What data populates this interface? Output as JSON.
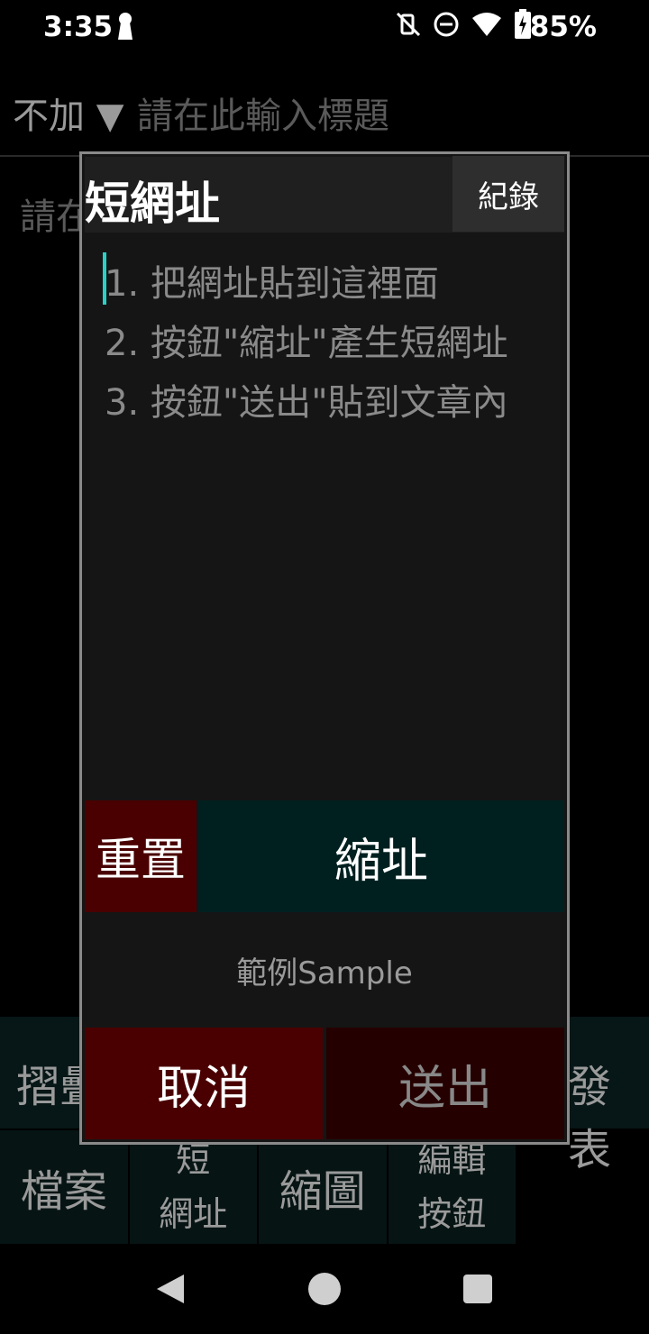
{
  "status_bar": {
    "time": "3:35",
    "battery": "85%",
    "icons": [
      "keyhole-icon",
      "vibrate-off-icon",
      "dnd-icon",
      "wifi-icon",
      "battery-charging-icon"
    ]
  },
  "editor": {
    "title_selector": "不加 ▼",
    "title_placeholder": "請在此輸入標題",
    "body_placeholder": "請在"
  },
  "toolbar": {
    "row1_left": "摺疊",
    "row1_right": "發表",
    "row2": [
      {
        "label": "檔案"
      },
      {
        "label_line1": "短",
        "label_line2": "網址"
      },
      {
        "label": "縮圖"
      },
      {
        "label_line1": "編輯",
        "label_line2": "按鈕"
      }
    ]
  },
  "dialog": {
    "title": "短網址",
    "history_button": "紀錄",
    "placeholder": "1. 把網址貼到這裡面\n2. 按鈕\"縮址\"產生短網址\n3. 按鈕\"送出\"貼到文章內",
    "reset_button": "重置",
    "shorten_button": "縮址",
    "sample_link": "範例Sample",
    "cancel_button": "取消",
    "submit_button": "送出"
  },
  "colors": {
    "cursor": "#2ad0c6",
    "reset_bg": "#4a0000",
    "shorten_bg": "#002020",
    "cancel_bg": "#4a0000",
    "submit_bg": "#250000"
  }
}
